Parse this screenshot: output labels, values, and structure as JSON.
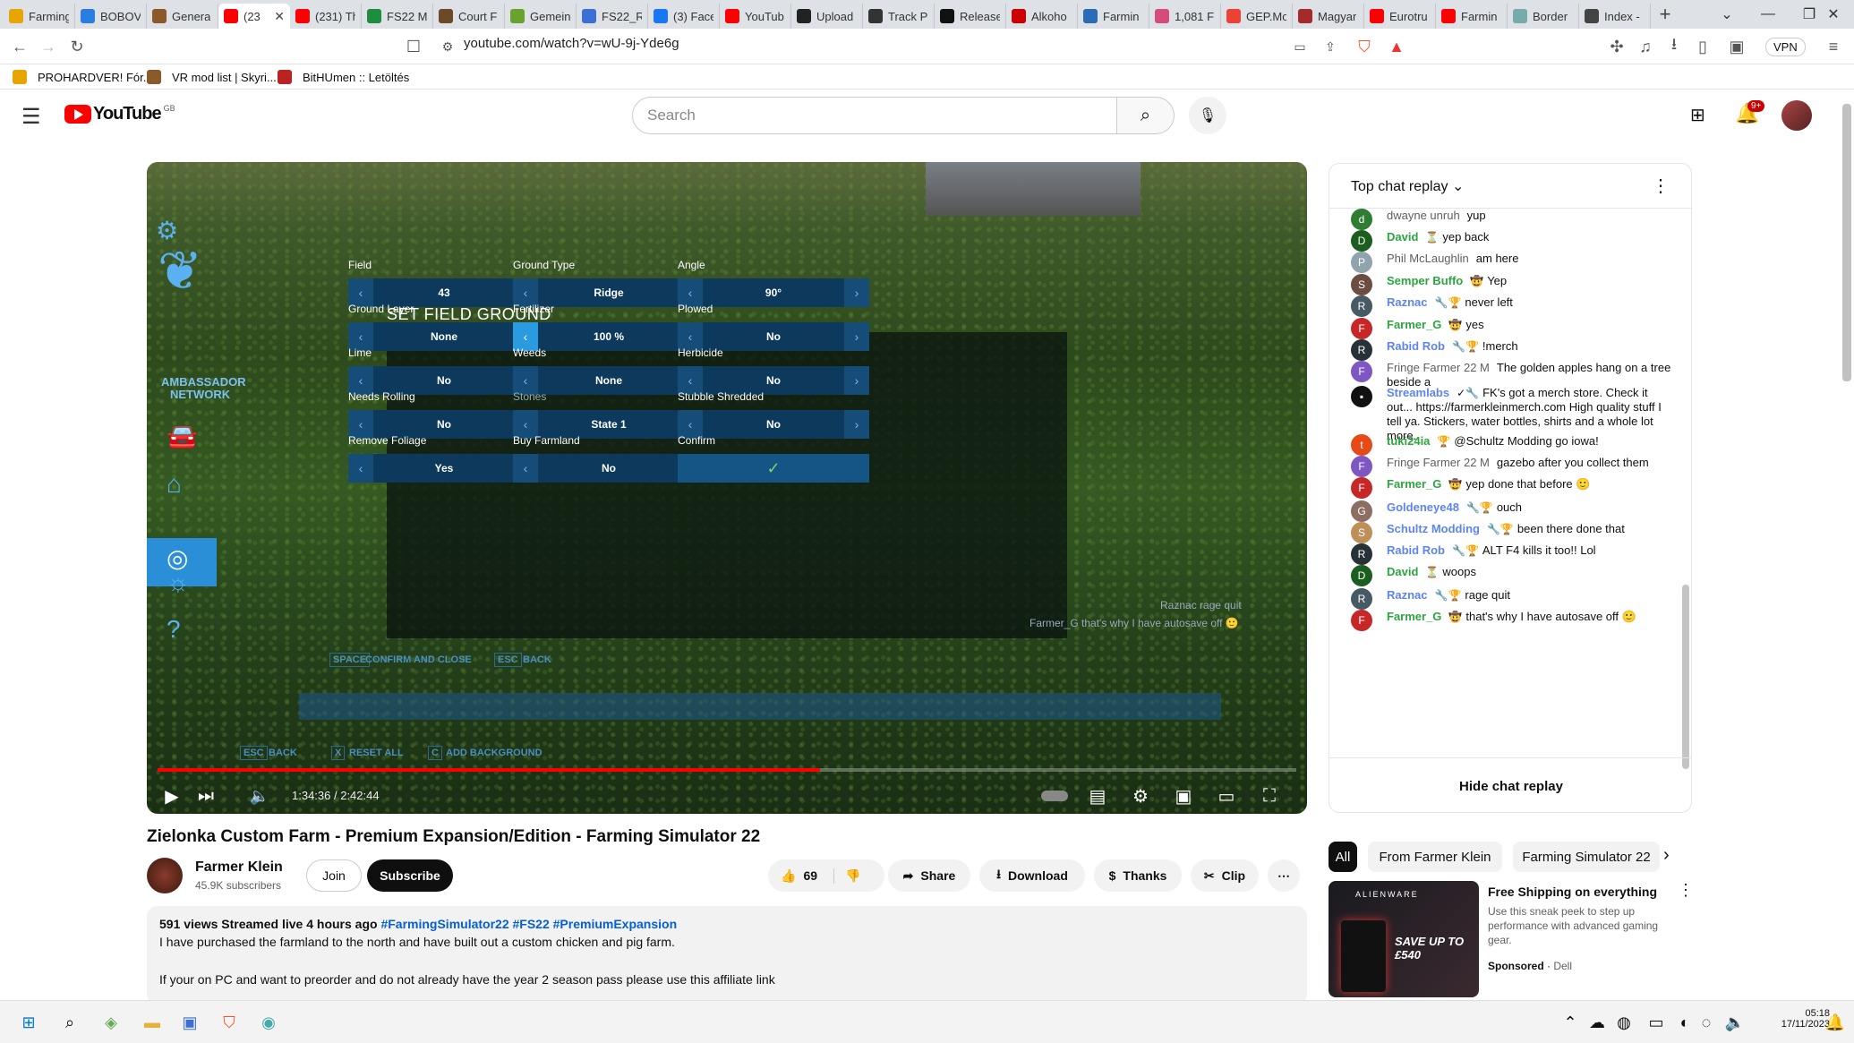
{
  "browser": {
    "tabs": [
      {
        "label": "Farming",
        "color": "#e7a500"
      },
      {
        "label": "BOBOV",
        "color": "#2a7de1"
      },
      {
        "label": "Genera",
        "color": "#8a5a2b"
      },
      {
        "label": "(23",
        "color": "#ff0000",
        "active": true
      },
      {
        "label": "(231) Th",
        "color": "#ff0000"
      },
      {
        "label": "FS22 M",
        "color": "#1e8e3e"
      },
      {
        "label": "Court F",
        "color": "#6b4a2a"
      },
      {
        "label": "Gemein",
        "color": "#6aa12f"
      },
      {
        "label": "FS22_R",
        "color": "#3b6fd6"
      },
      {
        "label": "(3) Face",
        "color": "#1877f2"
      },
      {
        "label": "YouTub",
        "color": "#ff0000"
      },
      {
        "label": "Upload",
        "color": "#222222"
      },
      {
        "label": "Track P",
        "color": "#333333"
      },
      {
        "label": "Release",
        "color": "#111111"
      },
      {
        "label": "Alkoho",
        "color": "#cc0000"
      },
      {
        "label": "Farmin",
        "color": "#2b6db4"
      },
      {
        "label": "1,081 F",
        "color": "#d44c7a"
      },
      {
        "label": "GEP.Mo",
        "color": "#ea4335"
      },
      {
        "label": "Magyar",
        "color": "#a52a2a"
      },
      {
        "label": "Eurotru",
        "color": "#ff0000"
      },
      {
        "label": "Farmin",
        "color": "#ff0000"
      },
      {
        "label": "Border",
        "color": "#7aa"
      },
      {
        "label": "Index -",
        "color": "#444"
      }
    ],
    "url": "youtube.com/watch?v=wU-9j-Yde6g",
    "vpn": "VPN",
    "bookmarks": [
      "PROHARDVER! Fór...",
      "VR mod list | Skyri...",
      "BitHUmen :: Letöltés"
    ]
  },
  "yt": {
    "logo": "YouTube",
    "region": "GB",
    "search_placeholder": "Search",
    "notif_count": "9+"
  },
  "game": {
    "title": "SET FIELD GROUND",
    "settings": [
      {
        "label": "Field",
        "value": "43"
      },
      {
        "label": "Ground Type",
        "value": "Ridge"
      },
      {
        "label": "Angle",
        "value": "90°"
      },
      {
        "label": "Ground Layer",
        "value": "None"
      },
      {
        "label": "Fertilizer",
        "value": "100 %"
      },
      {
        "label": "Plowed",
        "value": "No"
      },
      {
        "label": "Lime",
        "value": "No"
      },
      {
        "label": "Weeds",
        "value": "None"
      },
      {
        "label": "Herbicide",
        "value": "No"
      },
      {
        "label": "Needs Rolling",
        "value": "No"
      },
      {
        "label": "Stones",
        "value": "State 1"
      },
      {
        "label": "Stubble Shredded",
        "value": "No"
      },
      {
        "label": "Remove Foliage",
        "value": "Yes"
      },
      {
        "label": "Buy Farmland",
        "value": "No"
      },
      {
        "label": "Confirm",
        "value": "✓"
      }
    ],
    "hint_space": "SPACE",
    "hint_confirm": "CONFIRM AND CLOSE",
    "hint_esc": "ESC",
    "hint_back": "BACK",
    "hint2_esc": "ESC",
    "hint2_back": "BACK",
    "hint2_x": "X",
    "hint2_reset": "RESET ALL",
    "hint2_c": "C",
    "hint2_addbg": "ADD BACKGROUND",
    "brand": "AMBASSADOR",
    "brand2": "NETWORK",
    "overlay_chat1": "Raznac  rage quit",
    "overlay_chat2": "Farmer_G  that's why I have autosave off 🙂"
  },
  "player": {
    "time": "1:34:36 / 2:42:44",
    "progress": 0.5815
  },
  "video": {
    "title": "Zielonka Custom Farm - Premium Expansion/Edition - Farming Simulator 22",
    "channel": "Farmer Klein",
    "subscribers": "45.9K subscribers",
    "join": "Join",
    "subscribe": "Subscribe",
    "likes": "69",
    "share": "Share",
    "download": "Download",
    "thanks": "Thanks",
    "clip": "Clip",
    "views": "591 views  Streamed live 4 hours ago",
    "hashtags": "#FarmingSimulator22 #FS22 #PremiumExpansion",
    "desc1": "I have purchased the farmland to the north and have built out a custom chicken and pig farm.",
    "desc2": "If your on PC and want to preorder and do not already have the year 2 season pass please use this affiliate link"
  },
  "chat": {
    "header": "Top chat replay",
    "hide": "Hide chat replay",
    "messages": [
      {
        "author": "dwayne unruh",
        "text": "yup",
        "type": "plain",
        "avatar": "d",
        "color": "#2e7d32"
      },
      {
        "author": "David",
        "text": "yep back",
        "type": "mem",
        "badge": "⏳",
        "avatar": "D",
        "color": "#1b5e20"
      },
      {
        "author": "Phil McLaughlin",
        "text": "am here",
        "type": "plain",
        "avatar": "P",
        "color": "#90a4ae"
      },
      {
        "author": "Semper Buffo",
        "text": "Yep",
        "type": "mem",
        "badge": "🤠",
        "avatar": "S",
        "color": "#6d4c41"
      },
      {
        "author": "Raznac",
        "text": "never left",
        "type": "mod",
        "badge": "🔧🏆",
        "avatar": "R",
        "color": "#455a64"
      },
      {
        "author": "Farmer_G",
        "text": "yes",
        "type": "mem",
        "badge": "🤠",
        "avatar": "F",
        "color": "#c62828"
      },
      {
        "author": "Rabid Rob",
        "text": "!merch",
        "type": "mod",
        "badge": "🔧🏆",
        "avatar": "R",
        "color": "#263238"
      },
      {
        "author": "Fringe Farmer 22 M",
        "text": "The golden apples hang on a tree beside a",
        "type": "plain",
        "avatar": "F",
        "color": "#7e57c2"
      },
      {
        "author": "Streamlabs",
        "text": "FK's got a merch store. Check it out... https://farmerkleinmerch.com High quality stuff I tell ya. Stickers, water bottles, shirts and a whole lot more.",
        "type": "mod",
        "badge": "✓🔧",
        "avatar": "▪",
        "color": "#111111"
      },
      {
        "author": "tuki24ia",
        "text": "@Schultz Modding go iowa!",
        "type": "mem",
        "badge": "🏆",
        "avatar": "t",
        "color": "#e64a19"
      },
      {
        "author": "Fringe Farmer 22 M",
        "text": "gazebo after you collect them",
        "type": "plain",
        "avatar": "F",
        "color": "#7e57c2"
      },
      {
        "author": "Farmer_G",
        "text": "yep done that before 🙂",
        "type": "mem",
        "badge": "🤠",
        "avatar": "F",
        "color": "#c62828"
      },
      {
        "author": "Goldeneye48",
        "text": "ouch",
        "type": "mod",
        "badge": "🔧🏆",
        "avatar": "G",
        "color": "#8d6e63"
      },
      {
        "author": "Schultz Modding",
        "text": "been there done that",
        "type": "mod",
        "badge": "🔧🏆",
        "avatar": "S",
        "color": "#bf8f5a"
      },
      {
        "author": "Rabid Rob",
        "text": "ALT F4 kills it too!! Lol",
        "type": "mod",
        "badge": "🔧🏆",
        "avatar": "R",
        "color": "#263238"
      },
      {
        "author": "David",
        "text": "woops",
        "type": "mem",
        "badge": "⏳",
        "avatar": "D",
        "color": "#1b5e20"
      },
      {
        "author": "Raznac",
        "text": "rage quit",
        "type": "mod",
        "badge": "🔧🏆",
        "avatar": "R",
        "color": "#455a64"
      },
      {
        "author": "Farmer_G",
        "text": "that's why I have autosave off 🙂",
        "type": "mem",
        "badge": "🤠",
        "avatar": "F",
        "color": "#c62828"
      }
    ]
  },
  "chips": [
    "All",
    "From Farmer Klein",
    "Farming Simulator 22"
  ],
  "ad": {
    "title": "Free Shipping on everything",
    "text": "Use this sneak peek to step up performance with advanced gaming gear.",
    "sponsored": "Sponsored",
    "advertiser": "Dell",
    "thumb_brand": "ALIENWARE",
    "thumb_sale": "SAVE UP TO £540"
  },
  "taskbar": {
    "time": "05:18",
    "date": "17/11/2023"
  }
}
